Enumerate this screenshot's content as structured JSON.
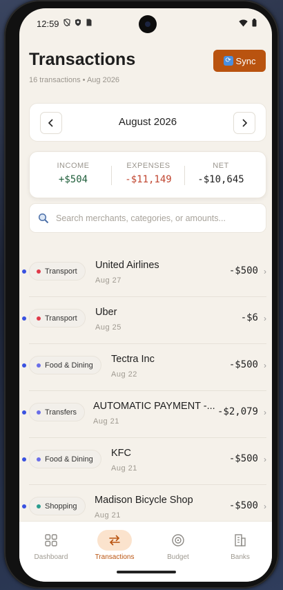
{
  "status": {
    "time": "12:59"
  },
  "header": {
    "title": "Transactions",
    "subtitle": "16 transactions • Aug 2026",
    "sync_label": "Sync",
    "sync_icon": "refresh-icon"
  },
  "month_nav": {
    "label": "August 2026"
  },
  "summary": {
    "income_label": "INCOME",
    "income_value": "+$504",
    "expenses_label": "EXPENSES",
    "expenses_value": "-$11,149",
    "net_label": "NET",
    "net_value": "-$10,645",
    "colors": {
      "income": "#1f5e3a",
      "expenses": "#c0452f",
      "net": "#1e1e1e"
    }
  },
  "search": {
    "placeholder": "Search merchants, categories, or amounts..."
  },
  "transactions": [
    {
      "category": "Transport",
      "category_color": "#e03a4a",
      "merchant": "United Airlines",
      "date": "Aug 27",
      "amount": "-$500"
    },
    {
      "category": "Transport",
      "category_color": "#e03a4a",
      "merchant": "Uber",
      "date": "Aug 25",
      "amount": "-$6"
    },
    {
      "category": "Food & Dining",
      "category_color": "#6a6ee8",
      "merchant": "Tectra Inc",
      "date": "Aug 22",
      "amount": "-$500"
    },
    {
      "category": "Transfers",
      "category_color": "#6a6ee8",
      "merchant": "AUTOMATIC PAYMENT -...",
      "date": "Aug 21",
      "amount": "-$2,079"
    },
    {
      "category": "Food & Dining",
      "category_color": "#6a6ee8",
      "merchant": "KFC",
      "date": "Aug 21",
      "amount": "-$500"
    },
    {
      "category": "Shopping",
      "category_color": "#2a9d8f",
      "merchant": "Madison Bicycle Shop",
      "date": "Aug 21",
      "amount": "-$500"
    }
  ],
  "bottom_nav": {
    "items": [
      {
        "label": "Dashboard",
        "icon": "grid-icon"
      },
      {
        "label": "Transactions",
        "icon": "swap-icon"
      },
      {
        "label": "Budget",
        "icon": "target-icon"
      },
      {
        "label": "Banks",
        "icon": "building-icon"
      }
    ],
    "active": "Transactions"
  },
  "accent_color": "#b9530f"
}
